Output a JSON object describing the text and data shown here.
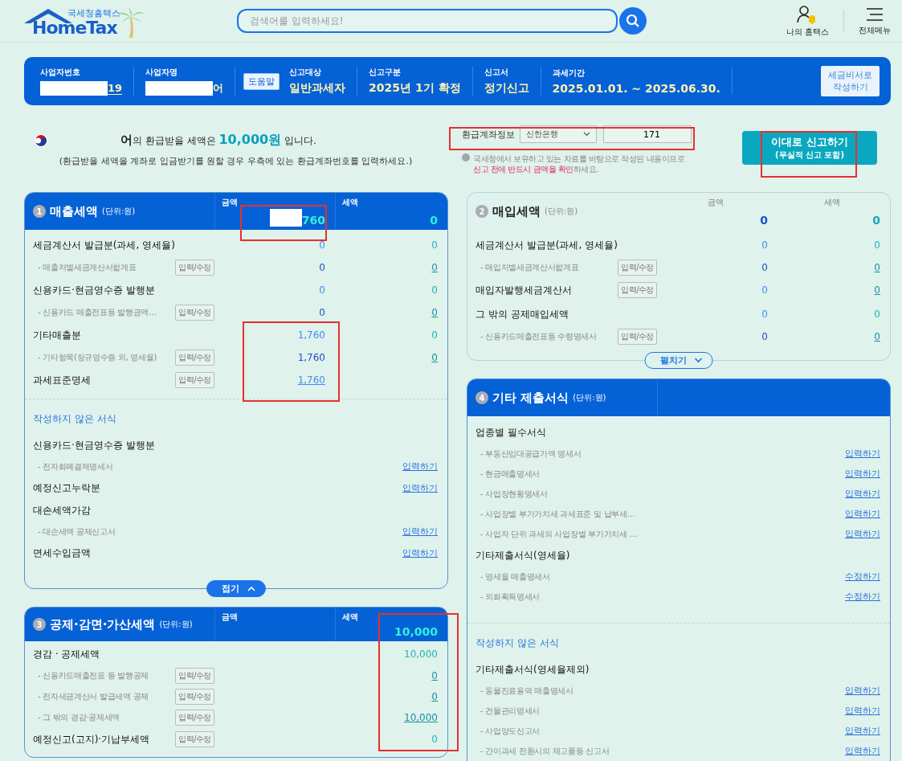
{
  "header": {
    "logo_small": "국세청홈택스",
    "logo_big": "HomeTax",
    "search": {
      "placeholder": "검색어를 입력하세요!"
    },
    "links": [
      {
        "kind": "my",
        "label": "나의 홈택스"
      },
      {
        "kind": "menu",
        "label": "전체메뉴"
      }
    ]
  },
  "info_bar": {
    "fields": [
      {
        "label": "사업자번호",
        "value": "19",
        "redacted": true,
        "underlined": true
      },
      {
        "label": "사업자명",
        "value": "어",
        "redacted": true,
        "underlined": false
      }
    ],
    "help": "도움말",
    "details": [
      {
        "label": "신고대상",
        "value": "일반과세자"
      },
      {
        "label": "신고구분",
        "value": "2025년 1기 확정"
      },
      {
        "label": "신고서",
        "value": "정기신고"
      },
      {
        "label": "과세기간",
        "value": "2025.01.01. ~ 2025.06.30."
      }
    ],
    "assist_button": [
      "세금비서로",
      "작성하기"
    ]
  },
  "refund": {
    "name": "어",
    "message": "의 환급받을 세액은 **10,000원** 입니다.",
    "hint": "(환급받을 세액을 계좌로 입금받기를 원할 경우 우측에 있는 환급계좌번호를 입력하세요.)",
    "account_label": "환급계좌정보",
    "bank": "신한은행",
    "account": "171",
    "notice": "국세청에서 보유하고 있는 자료를 바탕으로 작성된 내용이므로",
    "warning": "신고 전에 반드시 금액을 확인",
    "warning_tail": "하세요.",
    "submit": [
      "이대로 신고하기",
      "(무실적 신고 포함)"
    ]
  },
  "columns": [
    {
      "panels": [
        {
          "number": "1",
          "title": "매출세액",
          "unit": "(단위:원)",
          "kind": "highlighted",
          "amount_head": "금액",
          "tax_head": "세액",
          "amount_total": "760",
          "amount_redacted": true,
          "tax_total": "0",
          "rows": [
            {
              "kind": "main",
              "label": "세금계산서 발급분(과세, 영세율)",
              "amount": "0",
              "amount_link": false,
              "tax": "0",
              "tax_link": false
            },
            {
              "kind": "sub",
              "label": "- 매출처별세금계산서합계표",
              "edit": "입력/수정",
              "amount": "0",
              "amount_link": false,
              "tax": "0",
              "tax_link": true
            },
            {
              "kind": "main",
              "label": "신용카드·현금영수증 발행분",
              "amount": "0",
              "amount_link": false,
              "tax": "0",
              "tax_link": false
            },
            {
              "kind": "sub",
              "label": "- 신용카드 매출전표등 발행금액…",
              "edit": "입력/수정",
              "amount": "0",
              "amount_link": false,
              "tax": "0",
              "tax_link": true
            },
            {
              "kind": "main",
              "label": "기타매출분",
              "amount": "1,760",
              "amount_link": false,
              "tax": "0",
              "tax_link": false
            },
            {
              "kind": "sub",
              "label": "- 기타항목(정규영수증 외, 영세율)",
              "edit": "입력/수정",
              "amount": "1,760",
              "amount_link": false,
              "tax": "0",
              "tax_link": true
            },
            {
              "kind": "main",
              "label": "과세표준명세",
              "edit": "입력/수정",
              "amount": "1,760",
              "amount_link": true
            }
          ],
          "unwritten": {
            "title": "작성하지 않은 서식",
            "items": [
              {
                "kind": "group",
                "label": "신용카드·현금영수증 발행분"
              },
              {
                "kind": "item",
                "label": "- 전자화폐결제명세서",
                "action": "입력하기"
              },
              {
                "kind": "group",
                "label": "예정신고누락분",
                "action": "입력하기"
              },
              {
                "kind": "group",
                "label": "대손세액가감"
              },
              {
                "kind": "item",
                "label": "- 대손세액 공제신고서",
                "action": "입력하기"
              },
              {
                "kind": "group",
                "label": "면세수입금액",
                "action": "입력하기"
              }
            ]
          },
          "toggle": {
            "label": "접기",
            "expanded": true
          }
        },
        {
          "number": "3",
          "title": "공제·감면·가산세액",
          "unit": "(단위:원)",
          "kind": "highlighted",
          "amount_head": "금액",
          "tax_head": "세액",
          "tax_total": "10,000",
          "rows": [
            {
              "kind": "main",
              "label": "경감 · 공제세액",
              "tax": "10,000",
              "tax_link": false
            },
            {
              "kind": "sub",
              "label": "- 신용카드매출전표 등 발행공제",
              "edit": "입력/수정",
              "tax": "0",
              "tax_link": true
            },
            {
              "kind": "sub",
              "label": "- 전자세금계산서 발급세액 공제",
              "edit": "입력/수정",
              "tax": "0",
              "tax_link": true
            },
            {
              "kind": "sub",
              "label": "- 그 밖의 경감·공제세액",
              "edit": "입력/수정",
              "tax": "10,000",
              "tax_link": true
            },
            {
              "kind": "main",
              "label": "예정신고(고지)·기납부세액",
              "edit": "입력/수정",
              "tax": "0",
              "tax_link": false
            }
          ]
        }
      ]
    },
    {
      "panels": [
        {
          "number": "2",
          "title": "매입세액",
          "unit": "(단위:원)",
          "kind": "dimmed",
          "amount_head": "금액",
          "tax_head": "세액",
          "amount_total": "0",
          "tax_total": "0",
          "rows": [
            {
              "kind": "main",
              "label": "세금계산서 발급분(과세, 영세율)",
              "amount": "0",
              "amount_link": false,
              "tax": "0",
              "tax_link": false
            },
            {
              "kind": "sub",
              "label": "- 매입처별세금계산서합계표",
              "edit": "입력/수정",
              "amount": "0",
              "amount_link": false,
              "tax": "0",
              "tax_link": true
            },
            {
              "kind": "main",
              "label": "매입자발행세금계산서",
              "edit": "입력/수정",
              "amount": "0",
              "amount_link": false,
              "tax": "0",
              "tax_link": true
            },
            {
              "kind": "main",
              "label": "그 밖의 공제매입세액",
              "amount": "0",
              "amount_link": false,
              "tax": "0",
              "tax_link": false
            },
            {
              "kind": "sub",
              "label": "- 신용카드매출전표등 수령명세서",
              "edit": "입력/수정",
              "amount": "0",
              "amount_link": false,
              "tax": "0",
              "tax_link": true
            }
          ],
          "toggle": {
            "label": "펼치기",
            "expanded": false
          }
        },
        {
          "number": "4",
          "title": "기타 제출서식",
          "unit": "(단위:원)",
          "kind": "highlighted",
          "forms": [
            {
              "kind": "group",
              "label": "업종별 필수서식"
            },
            {
              "kind": "item",
              "label": "- 부동산임대공급가액 명세서",
              "action": "입력하기"
            },
            {
              "kind": "item",
              "label": "- 현금매출명세서",
              "action": "입력하기"
            },
            {
              "kind": "item",
              "label": "- 사업장현황명세서",
              "action": "입력하기"
            },
            {
              "kind": "item",
              "label": "- 사업장별 부가가치세 과세표준 및 납부세…",
              "action": "입력하기"
            },
            {
              "kind": "item",
              "label": "- 사업자 단위 과세의 사업장별 부가가치세 …",
              "action": "입력하기"
            },
            {
              "kind": "group",
              "label": "기타제출서식(영세율)"
            },
            {
              "kind": "item",
              "label": "- 영세율 매출명세서",
              "action": "수정하기"
            },
            {
              "kind": "item",
              "label": "- 외화획득명세서",
              "action": "수정하기"
            }
          ],
          "unwritten": {
            "title": "작성하지 않은 서식",
            "items": [
              {
                "kind": "group",
                "label": "기타제출서식(영세율제외)"
              },
              {
                "kind": "item",
                "label": "- 동물진료용역 매출명세서",
                "action": "입력하기"
              },
              {
                "kind": "item",
                "label": "- 건물관리명세서",
                "action": "입력하기"
              },
              {
                "kind": "item",
                "label": "- 사업양도신고서",
                "action": "입력하기"
              },
              {
                "kind": "item",
                "label": "- 간이과세 전환시의 재고품등 신고서",
                "action": "입력하기"
              }
            ]
          }
        }
      ]
    }
  ]
}
